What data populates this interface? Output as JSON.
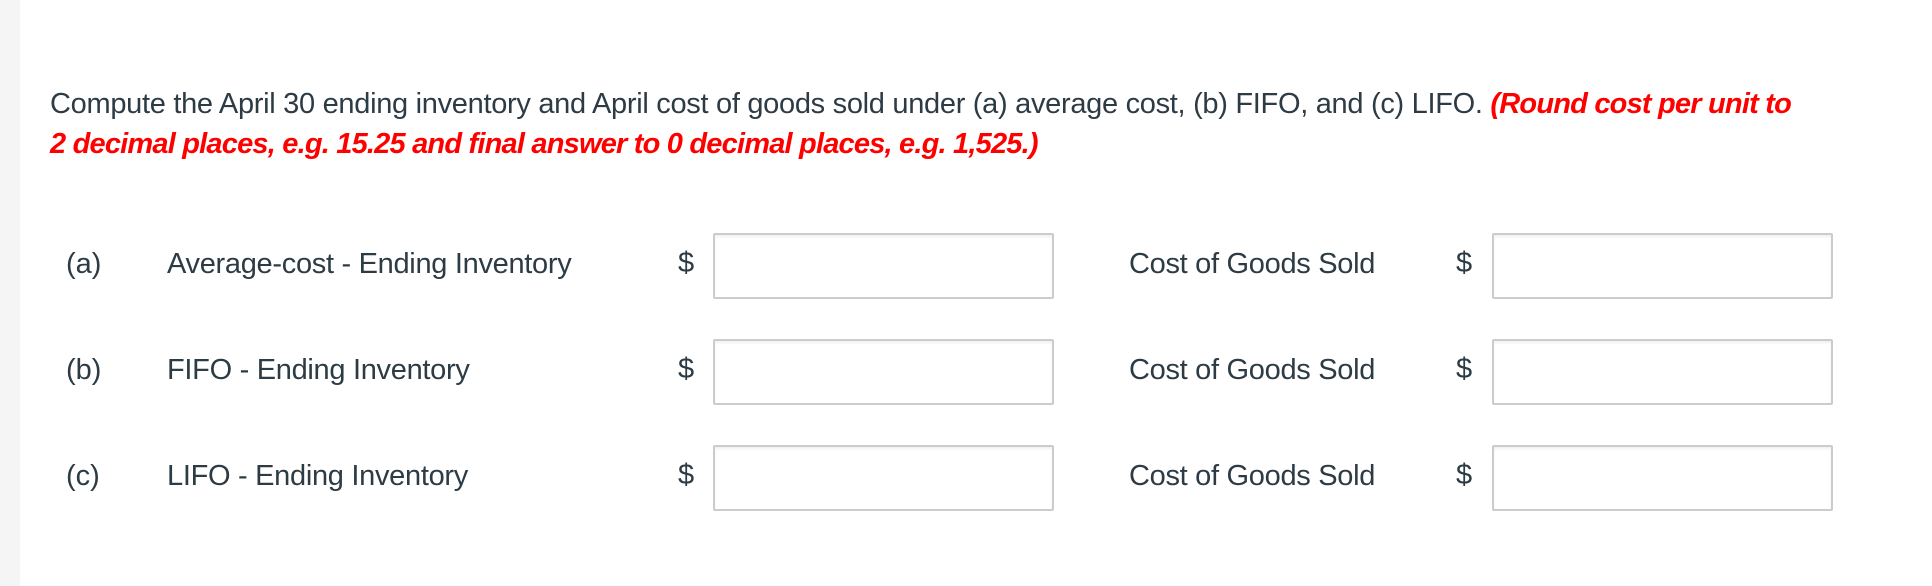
{
  "question": {
    "text": "Compute the April 30 ending inventory and April cost of goods sold under (a) average cost, (b) FIFO, and (c) LIFO. ",
    "hint_line1": "(Round cost per unit to",
    "hint_line2": "2 decimal places, e.g. 15.25 and final answer to 0 decimal places, e.g. 1,525.)"
  },
  "rows": [
    {
      "part": "(a)",
      "ending_inventory_label": "Average-cost - Ending Inventory",
      "currency": "$",
      "ending_inventory_value": "",
      "cogs_label": "Cost of Goods Sold",
      "cogs_currency": "$",
      "cogs_value": ""
    },
    {
      "part": "(b)",
      "ending_inventory_label": "FIFO - Ending Inventory",
      "currency": "$",
      "ending_inventory_value": "",
      "cogs_label": "Cost of Goods Sold",
      "cogs_currency": "$",
      "cogs_value": ""
    },
    {
      "part": "(c)",
      "ending_inventory_label": "LIFO - Ending Inventory",
      "currency": "$",
      "ending_inventory_value": "",
      "cogs_label": "Cost of Goods Sold",
      "cogs_currency": "$",
      "cogs_value": ""
    }
  ],
  "colors": {
    "text": "#2d3b45",
    "hint": "#ff0000",
    "input_border": "#cccccc"
  }
}
